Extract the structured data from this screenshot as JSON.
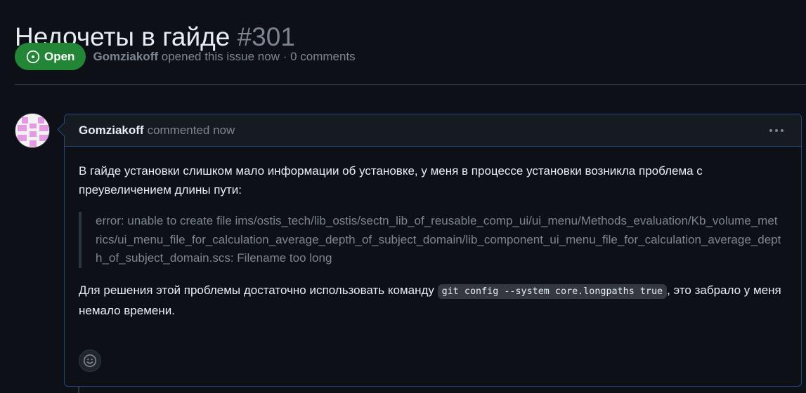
{
  "issue": {
    "title": "Недочеты в гайде",
    "number": "#301",
    "state_label": "Open",
    "author": "Gomziakoff",
    "opened_text": "opened this issue now · 0 comments"
  },
  "comment": {
    "author": "Gomziakoff",
    "action": "commented now",
    "paragraph1": "В гайде установки слишком мало информации об установке, у меня в процессе установки возникла проблема с преувеличением длины пути:",
    "quote": "error: unable to create file ims/ostis_tech/lib_ostis/sectn_lib_of_reusable_comp_ui/ui_menu/Methods_evaluation/Kb_volume_metrics/ui_menu_file_for_calculation_average_depth_of_subject_domain/lib_component_ui_menu_file_for_calculation_average_depth_of_subject_domain.scs: Filename too long",
    "paragraph2_before": "Для решения этой проблемы достаточно использовать команду ",
    "paragraph2_code": "git config --system core.longpaths true",
    "paragraph2_after": ", это забрало у меня немало времени."
  },
  "colors": {
    "background": "#0d1117",
    "open_badge": "#238636",
    "muted_text": "#7d8590",
    "comment_border": "#1f4a82"
  },
  "icons": {
    "state": "issue-opened-icon",
    "menu": "kebab-horizontal-icon",
    "reaction": "smiley-icon"
  }
}
